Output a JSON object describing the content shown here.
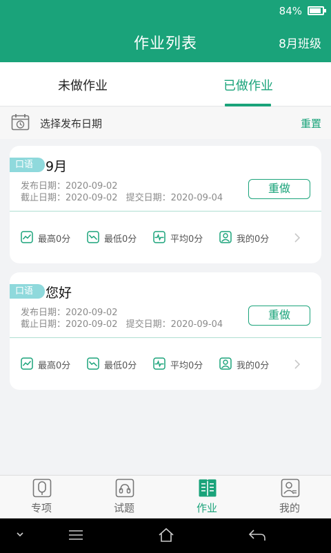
{
  "status_bar": {
    "battery": "84%",
    "icon": "battery-icon"
  },
  "header": {
    "title": "作业列表",
    "class_selector": "8月班级"
  },
  "tabs": [
    {
      "label": "未做作业",
      "active": false
    },
    {
      "label": "已做作业",
      "active": true
    }
  ],
  "filter": {
    "label": "选择发布日期",
    "reset": "重置",
    "icon": "calendar-icon"
  },
  "assignments": [
    {
      "tag": "口语",
      "name": "9月",
      "publish": "发布日期：2020-09-02",
      "deadline": "截止日期：2020-09-02",
      "submitted": "提交日期：2020-09-04",
      "redo": "重做",
      "stats": {
        "max": "最高0分",
        "min": "最低0分",
        "avg": "平均0分",
        "mine": "我的0分"
      }
    },
    {
      "tag": "口语",
      "name": "您好",
      "publish": "发布日期：2020-09-02",
      "deadline": "截止日期：2020-09-02",
      "submitted": "提交日期：2020-09-04",
      "redo": "重做",
      "stats": {
        "max": "最高0分",
        "min": "最低0分",
        "avg": "平均0分",
        "mine": "我的0分"
      }
    }
  ],
  "bottom_nav": [
    {
      "label": "专项",
      "icon": "special-icon",
      "active": false
    },
    {
      "label": "试题",
      "icon": "exam-icon",
      "active": false
    },
    {
      "label": "作业",
      "icon": "homework-icon",
      "active": true
    },
    {
      "label": "我的",
      "icon": "profile-icon",
      "active": false
    }
  ],
  "colors": {
    "accent": "#1aa37a",
    "tag": "#8fd9dc"
  }
}
